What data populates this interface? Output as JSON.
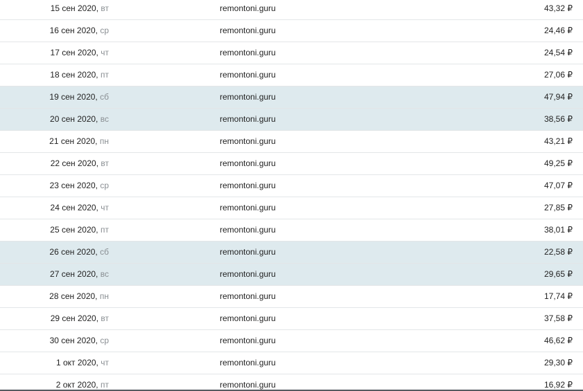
{
  "currency_symbol": "₽",
  "rows": [
    {
      "date": "15 сен 2020,",
      "weekday": "вт",
      "site": "remontoni.guru",
      "amount": "43,32",
      "weekend": false
    },
    {
      "date": "16 сен 2020,",
      "weekday": "ср",
      "site": "remontoni.guru",
      "amount": "24,46",
      "weekend": false
    },
    {
      "date": "17 сен 2020,",
      "weekday": "чт",
      "site": "remontoni.guru",
      "amount": "24,54",
      "weekend": false
    },
    {
      "date": "18 сен 2020,",
      "weekday": "пт",
      "site": "remontoni.guru",
      "amount": "27,06",
      "weekend": false
    },
    {
      "date": "19 сен 2020,",
      "weekday": "сб",
      "site": "remontoni.guru",
      "amount": "47,94",
      "weekend": true
    },
    {
      "date": "20 сен 2020,",
      "weekday": "вс",
      "site": "remontoni.guru",
      "amount": "38,56",
      "weekend": true
    },
    {
      "date": "21 сен 2020,",
      "weekday": "пн",
      "site": "remontoni.guru",
      "amount": "43,21",
      "weekend": false
    },
    {
      "date": "22 сен 2020,",
      "weekday": "вт",
      "site": "remontoni.guru",
      "amount": "49,25",
      "weekend": false
    },
    {
      "date": "23 сен 2020,",
      "weekday": "ср",
      "site": "remontoni.guru",
      "amount": "47,07",
      "weekend": false
    },
    {
      "date": "24 сен 2020,",
      "weekday": "чт",
      "site": "remontoni.guru",
      "amount": "27,85",
      "weekend": false
    },
    {
      "date": "25 сен 2020,",
      "weekday": "пт",
      "site": "remontoni.guru",
      "amount": "38,01",
      "weekend": false
    },
    {
      "date": "26 сен 2020,",
      "weekday": "сб",
      "site": "remontoni.guru",
      "amount": "22,58",
      "weekend": true
    },
    {
      "date": "27 сен 2020,",
      "weekday": "вс",
      "site": "remontoni.guru",
      "amount": "29,65",
      "weekend": true
    },
    {
      "date": "28 сен 2020,",
      "weekday": "пн",
      "site": "remontoni.guru",
      "amount": "17,74",
      "weekend": false
    },
    {
      "date": "29 сен 2020,",
      "weekday": "вт",
      "site": "remontoni.guru",
      "amount": "37,58",
      "weekend": false
    },
    {
      "date": "30 сен 2020,",
      "weekday": "ср",
      "site": "remontoni.guru",
      "amount": "46,62",
      "weekend": false
    },
    {
      "date": "1 окт 2020,",
      "weekday": "чт",
      "site": "remontoni.guru",
      "amount": "29,30",
      "weekend": false
    },
    {
      "date": "2 окт 2020,",
      "weekday": "пт",
      "site": "remontoni.guru",
      "amount": "16,92",
      "weekend": false
    }
  ]
}
